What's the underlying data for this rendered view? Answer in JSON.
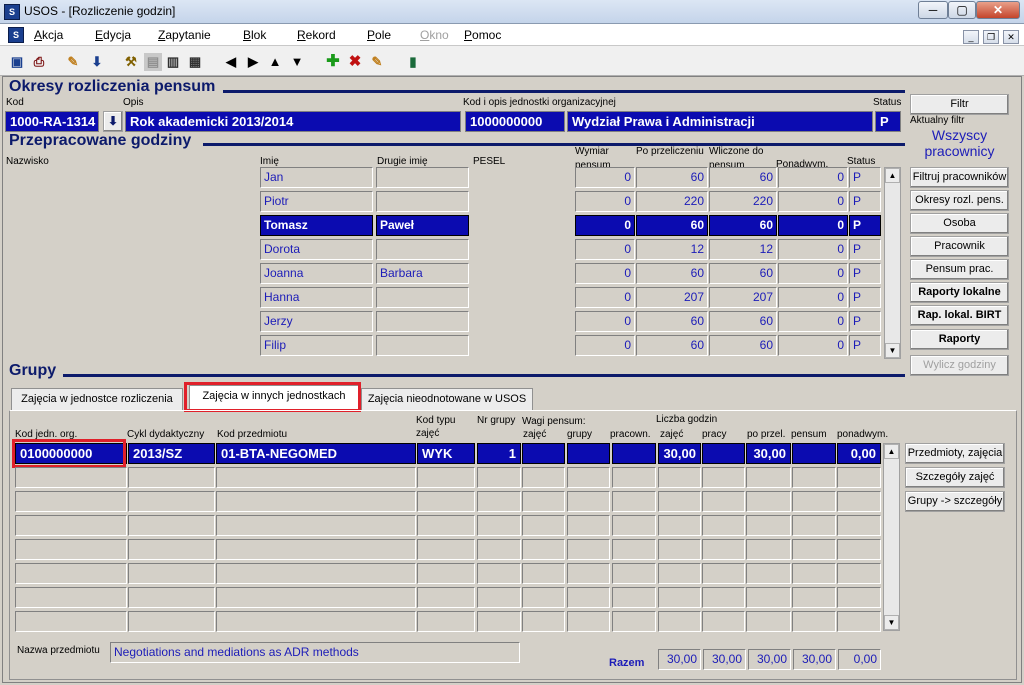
{
  "window": {
    "title": "USOS - [Rozliczenie godzin]",
    "app_icon": "S",
    "minimize": "─",
    "maximize": "▢",
    "close": "✕"
  },
  "menu": [
    "Akcja",
    "Edycja",
    "Zapytanie",
    "Blok",
    "Rekord",
    "Pole",
    "Okno",
    "Pomoc"
  ],
  "menu_disabled": "Okno",
  "okresy": {
    "title": "Okresy rozliczenia pensum",
    "kod_label": "Kod",
    "kod": "1000-RA-1314",
    "opis_label": "Opis",
    "opis": "Rok akademicki 2013/2014",
    "jed_label": "Kod i opis jednostki organizacyjnej",
    "jed_kod": "1000000000",
    "jed_opis": "Wydział Prawa i Administracji",
    "status_label": "Status",
    "status": "P"
  },
  "side": {
    "filtr": "Filtr",
    "aktualny_label": "Aktualny filtr",
    "aktualny": "Wszyscy pracownicy",
    "buttons": [
      "Filtruj pracowników",
      "Okresy rozl. pens.",
      "Osoba",
      "Pracownik",
      "Pensum prac.",
      "Raporty lokalne",
      "Rap. lokal. BIRT",
      "Raporty",
      "Wylicz godziny"
    ]
  },
  "godziny": {
    "title": "Przepracowane godziny",
    "headers": {
      "nazwisko": "Nazwisko",
      "imie": "Imię",
      "drugie": "Drugie imię",
      "pesel": "PESEL",
      "wymiar": "Wymiar pensum",
      "po": "Po przeliczeniu",
      "wliczone": "Wliczone do pensum",
      "ponad": "Ponadwym.",
      "status": "Status"
    },
    "rows": [
      {
        "imie": "Jan",
        "drugie": "",
        "wymiar": "0",
        "po": "60",
        "wliczone": "60",
        "ponad": "0",
        "status": "P"
      },
      {
        "imie": "Piotr",
        "drugie": "",
        "wymiar": "0",
        "po": "220",
        "wliczone": "220",
        "ponad": "0",
        "status": "P"
      },
      {
        "imie": "Tomasz",
        "drugie": "Paweł",
        "wymiar": "0",
        "po": "60",
        "wliczone": "60",
        "ponad": "0",
        "status": "P"
      },
      {
        "imie": "Dorota",
        "drugie": "",
        "wymiar": "0",
        "po": "12",
        "wliczone": "12",
        "ponad": "0",
        "status": "P"
      },
      {
        "imie": "Joanna",
        "drugie": "Barbara",
        "wymiar": "0",
        "po": "60",
        "wliczone": "60",
        "ponad": "0",
        "status": "P"
      },
      {
        "imie": "Hanna",
        "drugie": "",
        "wymiar": "0",
        "po": "207",
        "wliczone": "207",
        "ponad": "0",
        "status": "P"
      },
      {
        "imie": "Jerzy",
        "drugie": "",
        "wymiar": "0",
        "po": "60",
        "wliczone": "60",
        "ponad": "0",
        "status": "P"
      },
      {
        "imie": "Filip",
        "drugie": "",
        "wymiar": "0",
        "po": "60",
        "wliczone": "60",
        "ponad": "0",
        "status": "P"
      }
    ],
    "selected_row": 2
  },
  "grupy": {
    "title": "Grupy",
    "tabs": [
      "Zajęcia w jednostce rozliczenia",
      "Zajęcia w innych jednostkach",
      "Zajęcia nieodnotowane w USOS"
    ],
    "active_tab": 1,
    "headers": {
      "kod_jedn": "Kod jedn. org.",
      "cykl": "Cykl dydaktyczny",
      "kod_przedm": "Kod przedmiotu",
      "kod_typu": "Kod typu zajęć",
      "nr": "Nr grupy",
      "wagi": "Wagi pensum:",
      "zajec": "zajęć",
      "grupy": "grupy",
      "pracown": "pracown.",
      "liczba": "Liczba godzin",
      "lzajec": "zajęć",
      "pracy": "pracy",
      "poprzel": "po przel.",
      "pensum": "pensum",
      "ponad": "ponadwym."
    },
    "row": {
      "kod_jedn": "0100000000",
      "cykl": "2013/SZ",
      "kod_przedm": "01-BTA-NEGOMED",
      "kod_typu": "WYK",
      "nr": "1",
      "wz": "",
      "wg": "",
      "wp": "",
      "lzajec": "30,00",
      "pracy": "",
      "poprzel": "30,00",
      "pensum": "",
      "ponad": "0,00"
    },
    "buttons": [
      "Przedmioty, zajęcia",
      "Szczegóły zajęć",
      "Grupy -> szczegóły"
    ],
    "nazwa_label": "Nazwa przedmiotu",
    "nazwa": "Negotiations and mediations as ADR methods",
    "razem_label": "Razem",
    "razem": [
      "30,00",
      "30,00",
      "30,00",
      "30,00",
      "0,00"
    ]
  },
  "colors": {
    "field_blue": "#0b0bb0",
    "section_navy": "#0c1a6b",
    "text_blue": "#1c1cb8",
    "highlight_red": "#e0202a"
  }
}
